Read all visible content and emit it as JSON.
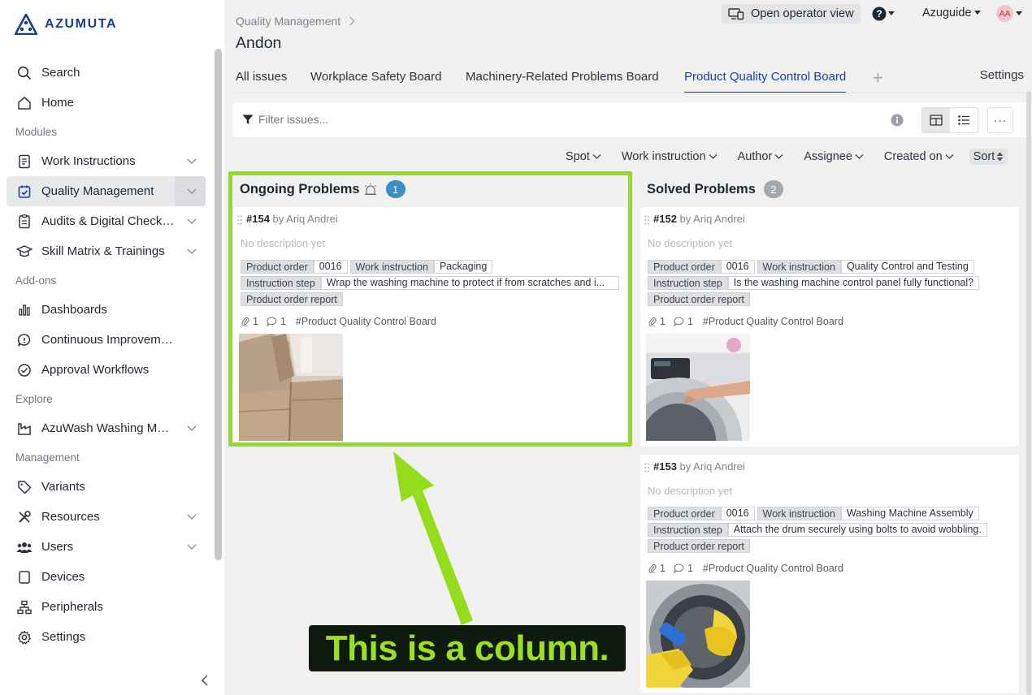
{
  "app": {
    "logo_text": "AZUMUTA"
  },
  "sidebar": {
    "items": [
      {
        "type": "item",
        "label": "Search",
        "icon": "search-icon"
      },
      {
        "type": "item",
        "label": "Home",
        "icon": "home-icon"
      },
      {
        "type": "section",
        "label": "Modules"
      },
      {
        "type": "item",
        "label": "Work Instructions",
        "icon": "document-icon",
        "expandable": true
      },
      {
        "type": "item",
        "label": "Quality Management",
        "icon": "clipboard-check-icon",
        "expandable": true,
        "active": true
      },
      {
        "type": "item",
        "label": "Audits & Digital Checklists",
        "icon": "checklist-icon",
        "expandable": true
      },
      {
        "type": "item",
        "label": "Skill Matrix & Trainings",
        "icon": "graduation-cap-icon",
        "expandable": true
      },
      {
        "type": "section",
        "label": "Add-ons"
      },
      {
        "type": "item",
        "label": "Dashboards",
        "icon": "bar-chart-icon"
      },
      {
        "type": "item",
        "label": "Continuous Improvement",
        "icon": "speech-bubble-icon"
      },
      {
        "type": "item",
        "label": "Approval Workflows",
        "icon": "check-circle-icon"
      },
      {
        "type": "section",
        "label": "Explore"
      },
      {
        "type": "item",
        "label": "AzuWash Washing Machines",
        "icon": "factory-icon",
        "expandable": true
      },
      {
        "type": "section",
        "label": "Management"
      },
      {
        "type": "item",
        "label": "Variants",
        "icon": "tag-icon"
      },
      {
        "type": "item",
        "label": "Resources",
        "icon": "tools-icon",
        "expandable": true
      },
      {
        "type": "item",
        "label": "Users",
        "icon": "users-icon",
        "expandable": true
      },
      {
        "type": "item",
        "label": "Devices",
        "icon": "tablet-icon"
      },
      {
        "type": "item",
        "label": "Peripherals",
        "icon": "network-icon"
      },
      {
        "type": "item",
        "label": "Settings",
        "icon": "gear-icon"
      }
    ]
  },
  "header": {
    "breadcrumb": "Quality Management",
    "title": "Andon",
    "operator_view": "Open operator view",
    "org": "Azuguide",
    "avatar_initials": "AA"
  },
  "tabs": [
    {
      "label": "All issues"
    },
    {
      "label": "Workplace Safety Board"
    },
    {
      "label": "Machinery-Related Problems Board"
    },
    {
      "label": "Product Quality Control Board",
      "active": true
    }
  ],
  "tab_settings": "Settings",
  "filter": {
    "placeholder": "Filter issues..."
  },
  "sort_fields": [
    "Spot",
    "Work instruction",
    "Author",
    "Assignee",
    "Created on"
  ],
  "sort_label": "Sort",
  "columns": [
    {
      "title": "Ongoing Problems",
      "count": "1",
      "badge_color": "#3d8fc4",
      "cards": [
        {
          "id": "#154",
          "by": "by Ariq Andrei",
          "description": "No description yet",
          "product_order_key": "Product order",
          "product_order": "0016",
          "work_instruction_key": "Work instruction",
          "work_instruction": "Packaging",
          "step_key": "Instruction step",
          "step": "Wrap the washing machine to protect if from scratches and i...",
          "report": "Product order report",
          "attachments": "1",
          "comments": "1",
          "board_tag": "Product Quality Control Board",
          "image": "cardboard-boxes"
        }
      ]
    },
    {
      "title": "Solved Problems",
      "count": "2",
      "badge_color": "#a5a8ad",
      "cards": [
        {
          "id": "#152",
          "by": "by Ariq Andrei",
          "description": "No description yet",
          "product_order_key": "Product order",
          "product_order": "0016",
          "work_instruction_key": "Work instruction",
          "work_instruction": "Quality Control and Testing",
          "step_key": "Instruction step",
          "step": "Is the washing machine control panel fully functional?",
          "report": "Product order report",
          "attachments": "1",
          "comments": "1",
          "board_tag": "Product Quality Control Board",
          "image": "washing-machine-panel"
        },
        {
          "id": "#153",
          "by": "by Ariq Andrei",
          "description": "No description yet",
          "product_order_key": "Product order",
          "product_order": "0016",
          "work_instruction_key": "Work instruction",
          "work_instruction": "Washing Machine Assembly",
          "step_key": "Instruction step",
          "step": "Attach the drum securely using bolts to avoid wobbling.",
          "report": "Product order report",
          "attachments": "1",
          "comments": "1",
          "board_tag": "Product Quality Control Board",
          "image": "washing-machine-drum-gloves"
        }
      ]
    }
  ],
  "annotation": {
    "text": "This is a column.",
    "color": "#94dc1c"
  }
}
